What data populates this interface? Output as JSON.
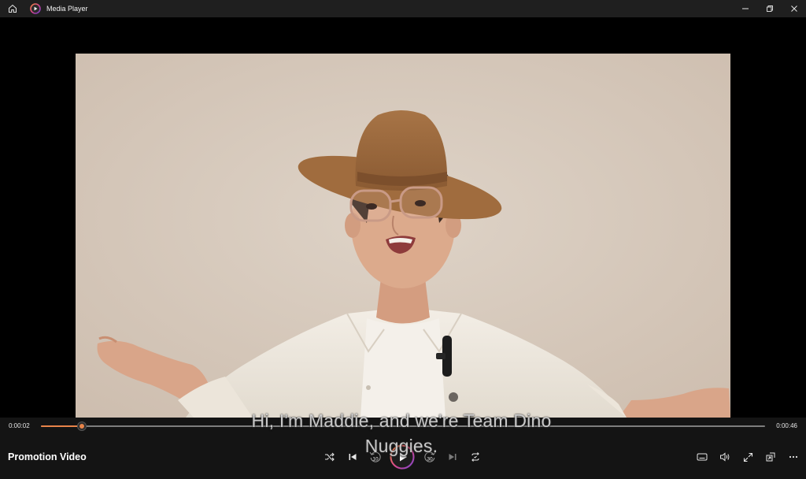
{
  "titlebar": {
    "title": "Media Player"
  },
  "player": {
    "current_time": "0:00:02",
    "total_time": "0:00:46",
    "progress": 0.056,
    "media_title": "Promotion Video",
    "subtitle_line1": "Hi, I'm Maddie, and we're Team Dino",
    "subtitle_line2": "Nuggies."
  },
  "icons": {
    "home": "home-icon",
    "app": "media-player-app-icon",
    "minimize": "minimize-icon",
    "restore": "restore-icon",
    "close": "close-icon",
    "shuffle": "shuffle-icon",
    "previous": "previous-track-icon",
    "skip_back": "skip-back-10-icon",
    "play": "play-icon",
    "skip_forward": "skip-forward-30-icon",
    "next": "next-track-icon",
    "repeat": "repeat-icon",
    "captions": "captions-icon",
    "volume": "volume-icon",
    "fullscreen": "fullscreen-icon",
    "mini_player": "mini-player-icon",
    "more": "more-options-icon"
  },
  "skip_back_seconds": "10",
  "skip_forward_seconds": "30",
  "colors": {
    "accent": "#e8844a",
    "accent_ring": "#d9478f",
    "bar_bg": "#161616",
    "titlebar_bg": "#1f1f1f"
  }
}
